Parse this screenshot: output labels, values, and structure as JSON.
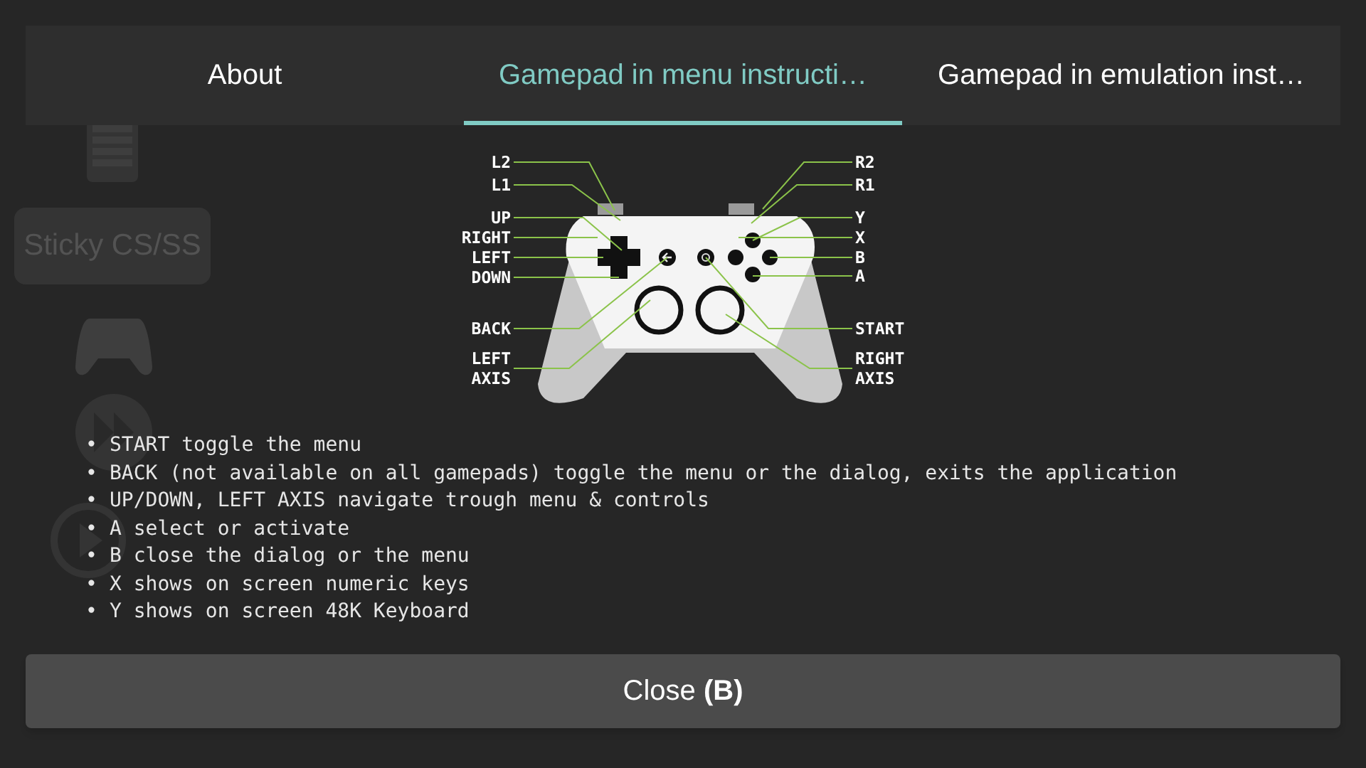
{
  "background_sidebar": {
    "button": "Sticky CS/SS"
  },
  "tabs": [
    {
      "label": "About",
      "selected": false
    },
    {
      "label": "Gamepad in menu instructi…",
      "selected": true
    },
    {
      "label": "Gamepad in emulation inst…",
      "selected": false
    }
  ],
  "diagram": {
    "left_callouts": [
      {
        "lines": [
          "L2"
        ]
      },
      {
        "lines": [
          "L1"
        ]
      },
      {
        "lines": [
          "UP"
        ]
      },
      {
        "lines": [
          "RIGHT"
        ]
      },
      {
        "lines": [
          "LEFT"
        ]
      },
      {
        "lines": [
          "DOWN"
        ]
      },
      {
        "lines": [
          "BACK"
        ]
      },
      {
        "lines": [
          "LEFT",
          "AXIS"
        ]
      }
    ],
    "right_callouts": [
      {
        "lines": [
          "R2"
        ]
      },
      {
        "lines": [
          "R1"
        ]
      },
      {
        "lines": [
          "Y"
        ]
      },
      {
        "lines": [
          "X"
        ]
      },
      {
        "lines": [
          "B"
        ]
      },
      {
        "lines": [
          "A"
        ]
      },
      {
        "lines": [
          "START"
        ]
      },
      {
        "lines": [
          "RIGHT",
          "AXIS"
        ]
      }
    ]
  },
  "instructions": [
    {
      "bullet": "•",
      "text": "START toggle the menu"
    },
    {
      "bullet": "•",
      "text": "BACK (not available on all gamepads) toggle the menu or the dialog, exits the application"
    },
    {
      "bullet": "•",
      "text": "UP/DOWN, LEFT AXIS navigate trough menu & controls"
    },
    {
      "bullet": "•",
      "text": "A select or activate"
    },
    {
      "bullet": "•",
      "text": "B close the dialog or the menu"
    },
    {
      "bullet": "•",
      "text": "X shows on screen numeric keys"
    },
    {
      "bullet": "•",
      "text": "Y shows on screen 48K Keyboard"
    }
  ],
  "close_button": {
    "label": "Close **(B)**"
  }
}
